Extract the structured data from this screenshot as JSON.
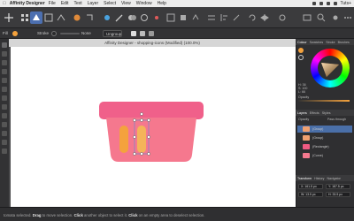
{
  "menubar": {
    "app_name": "Affinity Designer",
    "items": [
      "File",
      "Edit",
      "Text",
      "Layer",
      "Select",
      "View",
      "Window",
      "Help"
    ],
    "right_text": "Tuts+"
  },
  "document": {
    "title": "Affinity Designer - shopping-icons (Modified) (100.0%)"
  },
  "context_bar": {
    "fill_label": "Fill",
    "stroke_label": "Stroke",
    "stroke_value": "None",
    "align_label": "Ungroup"
  },
  "panels": {
    "color_tabs": [
      "Colour",
      "Swatches",
      "Stroke",
      "Brushes"
    ],
    "color_values": [
      "H: 36",
      "S: 100",
      "L: 66"
    ],
    "opacity_label": "Opacity",
    "layers_tabs": [
      "Layers",
      "Effects",
      "Styles"
    ],
    "layers_opacity": "Opacity",
    "blend_mode": "Pass through",
    "layers": [
      {
        "name": "(Group)",
        "color": "#f0a070"
      },
      {
        "name": "(Group)",
        "color": "#f0a070"
      },
      {
        "name": "(Rectangle)",
        "color": "#f05a82"
      },
      {
        "name": "(Curve)",
        "color": "#f5798e"
      }
    ],
    "transform_tabs": [
      "Transform",
      "History",
      "Navigator"
    ],
    "transform_values": [
      "X: 161.5 px",
      "Y: 187.5 px",
      "W: 13.5 px",
      "H: 33.5 px"
    ]
  },
  "status": {
    "parts": [
      {
        "text": "tomata selected. ",
        "bold": false
      },
      {
        "text": "Drag",
        "bold": true
      },
      {
        "text": " to move selection. ",
        "bold": false
      },
      {
        "text": "Click",
        "bold": true
      },
      {
        "text": " another object to select it. ",
        "bold": false
      },
      {
        "text": "Click",
        "bold": true
      },
      {
        "text": " on an empty area to deselect selection.",
        "bold": false
      }
    ]
  },
  "colors": {
    "basket_top": "#f0608a",
    "basket_body": "#f5788e",
    "accent": "#f4a23d",
    "selected": "#f4b45a"
  }
}
